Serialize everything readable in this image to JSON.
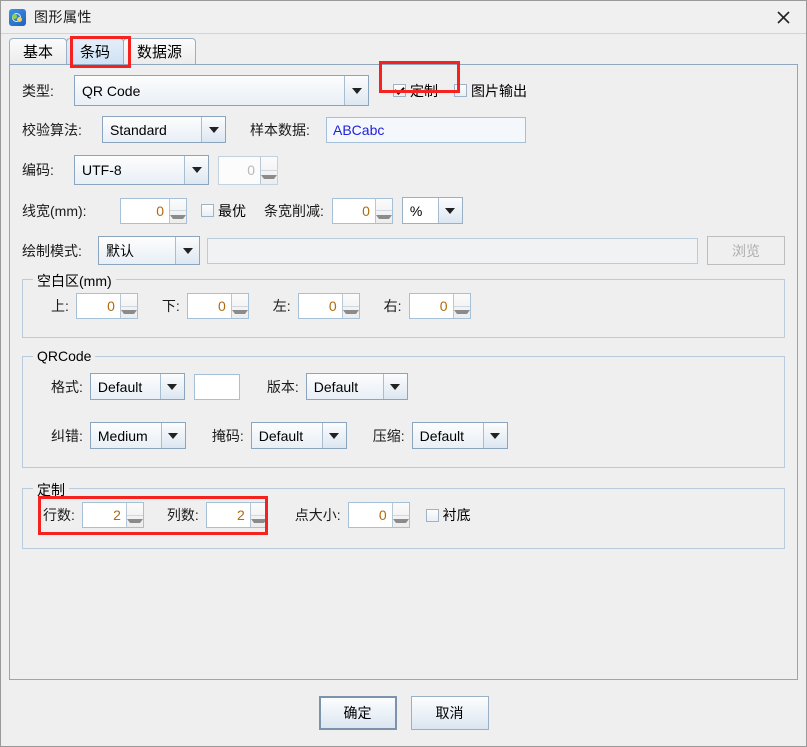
{
  "window": {
    "title": "图形属性",
    "icon": "shapes-icon",
    "close_icon": "close-icon"
  },
  "tabs": [
    {
      "label": "基本",
      "selected": false
    },
    {
      "label": "条码",
      "selected": true
    },
    {
      "label": "数据源",
      "selected": false
    }
  ],
  "form": {
    "type_label": "类型:",
    "type_value": "QR Code",
    "custom_checkbox": {
      "label": "定制",
      "checked": true
    },
    "image_output_checkbox": {
      "label": "图片输出",
      "checked": false
    },
    "checksum_label": "校验算法:",
    "checksum_value": "Standard",
    "sample_label": "样本数据:",
    "sample_value": "ABCabc",
    "sample_color": "#2222dd",
    "encoding_label": "编码:",
    "encoding_value": "UTF-8",
    "encoding_spinner_value": "0",
    "linewidth_label": "线宽(mm):",
    "linewidth_value": "0",
    "optimal_checkbox": {
      "label": "最优",
      "checked": false
    },
    "barreduce_label": "条宽削减:",
    "barreduce_value": "0",
    "barreduce_unit": "%",
    "drawmode_label": "绘制模式:",
    "drawmode_value": "默认",
    "drawmode_path": "",
    "browse_button": "浏览"
  },
  "quiet_zone": {
    "title": "空白区(mm)",
    "fields": [
      {
        "label": "上:",
        "value": "0"
      },
      {
        "label": "下:",
        "value": "0"
      },
      {
        "label": "左:",
        "value": "0"
      },
      {
        "label": "右:",
        "value": "0"
      }
    ]
  },
  "qrcode": {
    "title": "QRCode",
    "format_label": "格式:",
    "format_value": "Default",
    "format_extra": "",
    "version_label": "版本:",
    "version_value": "Default",
    "ecc_label": "纠错:",
    "ecc_value": "Medium",
    "mask_label": "掩码:",
    "mask_value": "Default",
    "compress_label": "压缩:",
    "compress_value": "Default"
  },
  "custom": {
    "title": "定制",
    "rows_label": "行数:",
    "rows_value": "2",
    "cols_label": "列数:",
    "cols_value": "2",
    "dotsize_label": "点大小:",
    "dotsize_value": "0",
    "backing_checkbox": {
      "label": "衬底",
      "checked": false
    }
  },
  "footer": {
    "ok_button": "确定",
    "cancel_button": "取消"
  },
  "annotations": {
    "highlight_color": "#f4231f"
  }
}
